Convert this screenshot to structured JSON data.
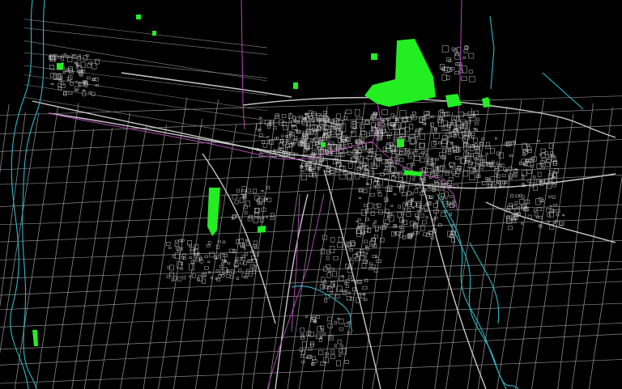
{
  "map": {
    "background": "#000000",
    "colors": {
      "road": "#c8c8c8",
      "road_dim": "#8a8a8a",
      "boundary": "#b04ab0",
      "river": "#2fb8c8",
      "park": "#22ee22"
    },
    "layers": [
      {
        "name": "streets",
        "color_key": "road"
      },
      {
        "name": "municipal-boundaries",
        "color_key": "boundary"
      },
      {
        "name": "rivers",
        "color_key": "river"
      },
      {
        "name": "green-areas",
        "color_key": "park"
      }
    ]
  }
}
